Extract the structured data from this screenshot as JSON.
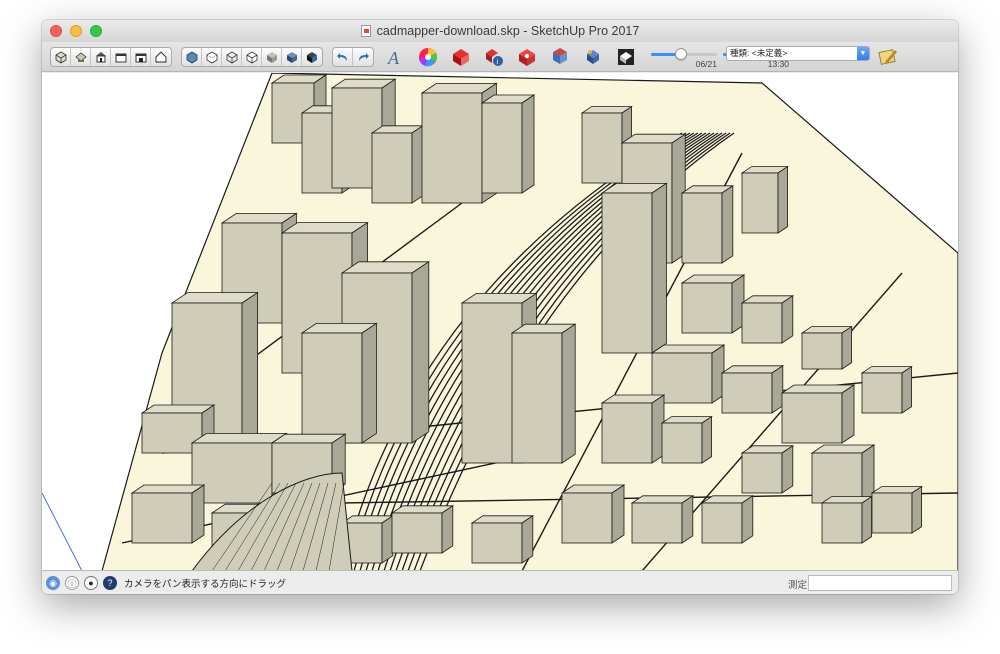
{
  "window": {
    "title": "cadmapper-download.skp - SketchUp Pro 2017"
  },
  "toolbar": {
    "camera_group": [
      "iso-view-icon",
      "top-view-icon",
      "front-view-icon",
      "right-view-icon",
      "back-view-icon",
      "left-view-icon"
    ],
    "style_group": [
      "xray-icon",
      "back-edges-icon",
      "wireframe-icon",
      "hidden-line-icon",
      "shaded-icon",
      "shaded-textures-icon",
      "monochrome-icon"
    ],
    "undo_redo": [
      "undo-icon",
      "redo-icon"
    ],
    "tools": [
      "text-icon",
      "colors-icon",
      "3d-warehouse-icon",
      "model-info-icon",
      "extension-warehouse-icon",
      "layout-icon",
      "shadows-icon"
    ],
    "shadow_date": {
      "value": "06/21",
      "fraction": 0.45
    },
    "shadow_time": {
      "value": "13:30",
      "fraction": 0.58
    },
    "style_label": "種類:",
    "style_value": "<未定義>",
    "style_options": [
      "<未定義>"
    ]
  },
  "status": {
    "hint": "カメラをパン表示する方向にドラッグ",
    "measure_label": "測定",
    "measure_value": ""
  },
  "colors": {
    "ground": "#f9f6dc",
    "building_face": "#cfcdb8",
    "building_side": "#a9a896",
    "outline": "#1a1a1a",
    "accent_blue": "#3d8ff5"
  }
}
